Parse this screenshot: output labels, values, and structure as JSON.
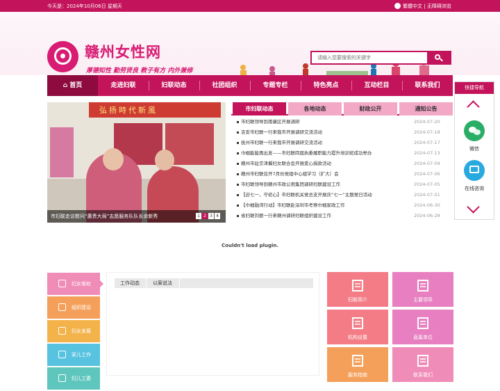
{
  "topbar": {
    "date": "今天是：2024年10月06日 星期天",
    "traditional": "繁體中文",
    "sep": "|",
    "accessible": "无障碍浏览"
  },
  "header": {
    "title": "赣州女性网",
    "slogan": "厚德知性  勤劳贤良  教子有方  内外兼修"
  },
  "search": {
    "placeholder": "请输入您要搜索的关键字"
  },
  "nav": [
    "首页",
    "走进妇联",
    "妇联动态",
    "社团组织",
    "专题专栏",
    "特色亮点",
    "互动栏目",
    "联系我们"
  ],
  "hero": {
    "banner_text": "弘扬時代新風",
    "caption": "市妇联走访慰问“惠贵大局”志愿服务队队长余新秀",
    "dots": [
      "1",
      "2",
      "3",
      "4"
    ],
    "active_dot": 1
  },
  "news_tabs": [
    "市妇联动态",
    "各地动态",
    "财政公开",
    "通知公告"
  ],
  "news": [
    {
      "title": "市妇联领导到南康区开展调研",
      "date": "2024-07-20"
    },
    {
      "title": "吉安市妇联一行来我市开展调研交流活动",
      "date": "2024-07-18"
    },
    {
      "title": "抚州市妇联一行来我市开展调研交流活动",
      "date": "2024-07-17"
    },
    {
      "title": "巾帼能能再出发——市妇联四届执委履职能力提升培训班成功举办",
      "date": "2024-07-13"
    },
    {
      "title": "赣州市驻京津冀妇女联合会开展爱心捐款活动",
      "date": "2024-07-09"
    },
    {
      "title": "赣州市妇联召开7月份党组中心组学习（扩大）会",
      "date": "2024-07-06"
    },
    {
      "title": "市妇联领导到赣州市政公用集团调研妇联建设工作",
      "date": "2024-07-05"
    },
    {
      "title": "【迎七一，守初心】市妇联机关党总支开展庆“七一”主题党日活动",
      "date": "2024-07-01"
    },
    {
      "title": "【巾帼融湾行动】市妇联赴深圳市考察巾帼家政工作",
      "date": "2024-06-30"
    },
    {
      "title": "省妇联刘丽一行来赣州调研妇联组织建设工作",
      "date": "2024-06-28"
    }
  ],
  "plugin_message": "Couldn't load plugin.",
  "quick_nav": {
    "title": "快捷导航",
    "wechat": "微信",
    "consult": "在线咨询"
  },
  "left_menu": [
    {
      "label": "妇女维权",
      "color": "#f08cb8"
    },
    {
      "label": "组织建设",
      "color": "#f5a05a"
    },
    {
      "label": "妇女发展",
      "color": "#f3b24a"
    },
    {
      "label": "家儿工作",
      "color": "#58c3e0"
    },
    {
      "label": "妇儿工委",
      "color": "#5fc6bd"
    }
  ],
  "centre_tabs": [
    "工作动态",
    "以案说法"
  ],
  "tiles": [
    {
      "label": "妇联简介",
      "color": "#f37c86"
    },
    {
      "label": "主要领导",
      "color": "#e77fc0"
    },
    {
      "label": "机构设置",
      "color": "#f37c86"
    },
    {
      "label": "直属单位",
      "color": "#e77fc0"
    },
    {
      "label": "服务指南",
      "color": "#f5a05a"
    },
    {
      "label": "联系我们",
      "color": "#f08cb8"
    }
  ]
}
